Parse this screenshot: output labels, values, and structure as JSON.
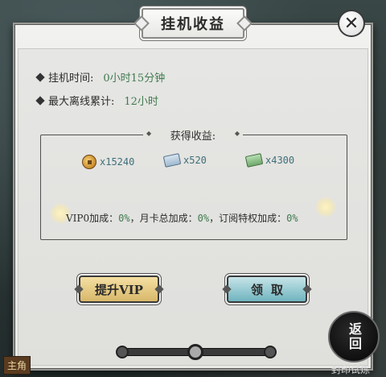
{
  "dialog": {
    "title": "挂机收益",
    "close_icon": "close-icon"
  },
  "info": {
    "idle_time_label": "挂机时间:",
    "idle_time_value": "0小时15分钟",
    "max_offline_label": "最大离线累计:",
    "max_offline_value": "12小时"
  },
  "rewards": {
    "section_label": "获得收益:",
    "items": [
      {
        "icon": "coin-icon",
        "amount": "x15240"
      },
      {
        "icon": "scroll-icon",
        "amount": "x520"
      },
      {
        "icon": "ticket-icon",
        "amount": "x4300"
      }
    ]
  },
  "bonus": {
    "vip_label": "VIP0加成：",
    "vip_value": "0%",
    "sep1": "，",
    "monthly_label": "月卡总加成：",
    "monthly_value": "0%",
    "sep2": "，",
    "sub_label": "订阅特权加成：",
    "sub_value": "0%"
  },
  "buttons": {
    "upgrade_vip": "提升VIP",
    "claim": "领取"
  },
  "overlay": {
    "back_label": "返回",
    "left_edge_text": "主角",
    "bottom_right_text": "封印试炼"
  },
  "colors": {
    "value_green": "#3f7a4e",
    "amount_teal": "#3f6f7a",
    "vip_gold": "#d8b86a",
    "claim_teal": "#6fb4bf"
  }
}
